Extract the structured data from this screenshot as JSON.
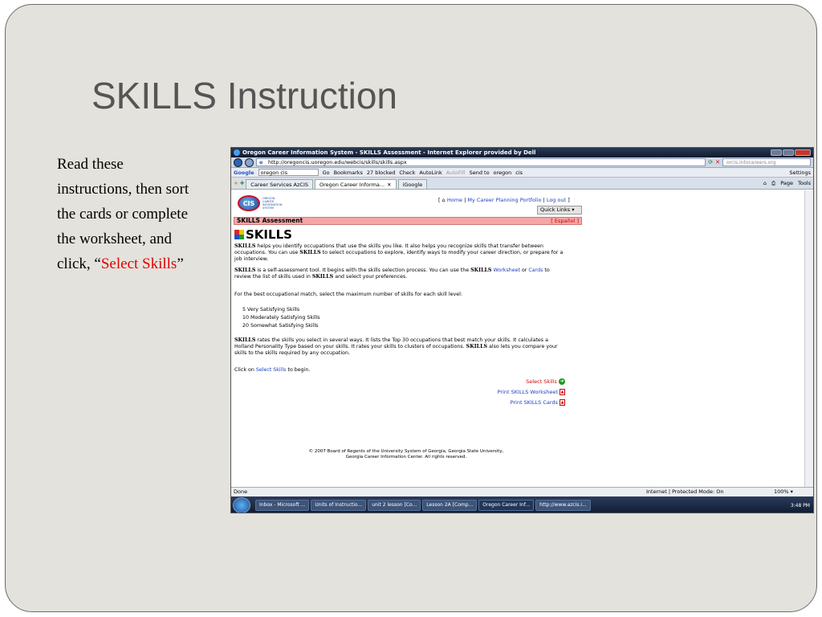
{
  "slide": {
    "title": "SKILLS Instruction",
    "body_prefix": "Read these instructions, then sort the cards or complete the worksheet, and click, “",
    "body_link": "Select Skills",
    "body_suffix": "”"
  },
  "browser": {
    "window_title": "Oregon Career Information System - SKILLS Assessment - Internet Explorer provided by Dell",
    "url": "http://oregoncis.uoregon.edu/webcis/skills/skills.aspx",
    "search_placeholder": "orcis.intocareers.org",
    "google": {
      "logo": "Google",
      "query": "oregon cis",
      "go": "Go",
      "bookmarks": "Bookmarks",
      "blocked": "27 blocked",
      "check": "Check",
      "autolink": "AutoLink",
      "autofill": "AutoFill",
      "send_to": "Send to",
      "term1": "oregon",
      "term2": "cis",
      "settings": "Settings"
    },
    "tabs": [
      {
        "label": "Career Services AzCIS"
      },
      {
        "label": "Oregon Career Informa..."
      },
      {
        "label": "iGoogle"
      }
    ],
    "cmd": {
      "page": "Page",
      "tools": "Tools"
    }
  },
  "page": {
    "logo_text": "CIS",
    "logo_caption": "OREGON CAREER INFORMATION SYSTEM",
    "top_links": {
      "home": "Home",
      "portfolio": "My Career Planning Portfolio",
      "logout": "Log out"
    },
    "quick_links": "Quick Links",
    "section_bar": "SKILLS Assessment",
    "espanol": "[ Español ]",
    "heading": "SKILLS",
    "p1_bold": "SKILLS",
    "p1": " helps you identify occupations that use the skills you like. It also helps you recognize skills that transfer between occupations. You can use ",
    "p1_bold2": "SKILLS",
    "p1b": " to select occupations to explore, identify ways to modify your career direction, or prepare for a job interview.",
    "p2_bold": "SKILLS",
    "p2": " is a self-assessment tool. It begins with the skills selection process. You can use the ",
    "p2_bold2": "SKILLS",
    "p2_link1": "Worksheet",
    "p2_or": " or ",
    "p2_link2": "Cards",
    "p2b": " to review the list of skills used in ",
    "p2_bold3": "SKILLS",
    "p2c": " and select your preferences.",
    "p3": "For the best occupational match, select the maximum number of skills for each skill level:",
    "levels": [
      "5  Very Satisfying Skills",
      "10  Moderately Satisfying Skills",
      "20  Somewhat Satisfying Skills"
    ],
    "p4_bold": "SKILLS",
    "p4": " rates the skills you select in several ways. It lists the Top 30 occupations that best match your skills. It calculates a Holland Personality Type based on your skills. It rates your skills to clusters of occupations. ",
    "p4_bold2": "SKILLS",
    "p4b": " also lets you compare your skills to the skills required by any occupation.",
    "p5": "Click on ",
    "p5_link": "Select Skills",
    "p5b": " to begin.",
    "select_skills": "Select Skills",
    "print_worksheet": "Print SKILLS Worksheet",
    "print_cards": "Print SKILLS Cards",
    "copyright_1": "© 2007 Board of Regents of the University System of Georgia, Georgia State University,",
    "copyright_2": "Georgia Career Information Center. All rights reserved."
  },
  "status": {
    "text": "Done",
    "zone": "Internet | Protected Mode: On",
    "zoom": "100%"
  },
  "taskbar": {
    "items": [
      "Inbox - Microsoft ...",
      "Units of Instructio...",
      "unit 2 lesson [Co...",
      "Lesson 2A [Comp...",
      "Oregon Career Inf...",
      "http://www.azcis.i..."
    ],
    "clock": "3:48 PM"
  }
}
